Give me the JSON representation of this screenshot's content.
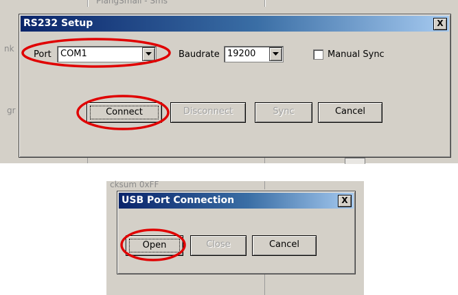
{
  "background": {
    "top_text": "PlangSmall - Sms",
    "left_text_1": "nk",
    "left_text_2": "gr",
    "bottom_text": "cksum 0xFF"
  },
  "rs232_dialog": {
    "title": "RS232 Setup",
    "close_label": "X",
    "port_label": "Port",
    "port_value": "COM1",
    "baudrate_label": "Baudrate",
    "baudrate_value": "19200",
    "manual_sync_label": "Manual Sync",
    "manual_sync_checked": false,
    "connect_label": "Connect",
    "disconnect_label": "Disconnect",
    "sync_label": "Sync",
    "cancel_label": "Cancel"
  },
  "usb_dialog": {
    "title": "USB Port Connection",
    "close_label": "X",
    "open_label": "Open",
    "close_btn_label": "Close",
    "cancel_label": "Cancel"
  },
  "colors": {
    "dialog_face": "#d4d0c8",
    "title_gradient_start": "#0a246a",
    "title_gradient_end": "#a6caf0",
    "annotation_red": "#e00000"
  }
}
